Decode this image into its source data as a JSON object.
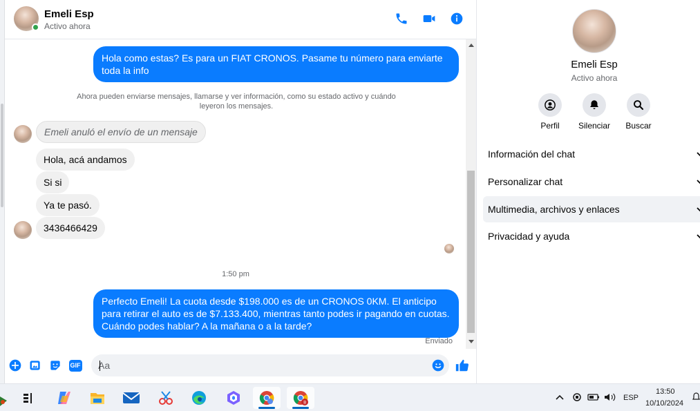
{
  "header": {
    "name": "Emeli Esp",
    "status": "Activo ahora",
    "icons": [
      "phone-icon",
      "video-icon",
      "info-icon"
    ]
  },
  "messages": {
    "m1": "Hola como estas?  Es para un FIAT CRONOS. Pasame tu número para enviarte toda la info",
    "system_note": "Ahora pueden enviarse mensajes, llamarse y ver información, como su estado activo y cuándo leyeron los mensajes.",
    "unsent": "Emeli anuló el envío de un mensaje",
    "in1": "Hola, acá andamos",
    "in2": "Si si",
    "in3": "Ya te pasó.",
    "in4": "3436466429",
    "time": "1:50 pm",
    "m2": "Perfecto Emeli! La cuota desde $198.000 es de un CRONOS 0KM. El anticipo para retirar el auto es de $7.133.400, mientras tanto podes ir pagando en cuotas. Cuándo podes hablar? A la mañana o a la tarde?",
    "sent_status": "Enviado"
  },
  "composer": {
    "placeholder": "Aa",
    "icons": [
      "plus-icon",
      "image-icon",
      "sticker-icon",
      "gif-icon",
      "emoji-icon",
      "like-icon"
    ],
    "gif_label": "GIF"
  },
  "info": {
    "name": "Emeli Esp",
    "status": "Activo ahora",
    "actions": [
      {
        "label": "Perfil",
        "icon": "profile-icon"
      },
      {
        "label": "Silenciar",
        "icon": "bell-icon"
      },
      {
        "label": "Buscar",
        "icon": "search-icon"
      }
    ],
    "sections": [
      {
        "label": "Información del chat"
      },
      {
        "label": "Personalizar chat"
      },
      {
        "label": "Multimedia, archivos y enlaces"
      },
      {
        "label": "Privacidad y ayuda"
      }
    ]
  },
  "taskbar": {
    "apps": [
      "task-view-icon",
      "copilot-icon",
      "file-explorer-icon",
      "mail-icon",
      "snipping-tool-icon",
      "edge-icon",
      "copilot-app-icon",
      "chrome-icon",
      "chrome-profile-icon"
    ],
    "language": "ESP",
    "time": "13:50",
    "date": "10/10/2024"
  },
  "colors": {
    "accent": "#0a7cff",
    "online": "#31a24c"
  }
}
